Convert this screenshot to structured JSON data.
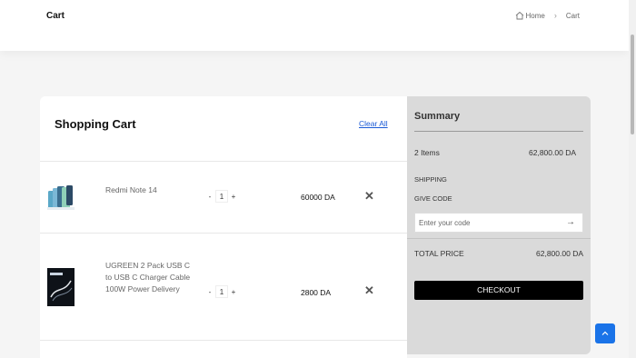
{
  "header": {
    "title": "Cart",
    "breadcrumb": {
      "home_label": "Home",
      "current_label": "Cart"
    }
  },
  "cart": {
    "title": "Shopping Cart",
    "clear_all_label": "Clear All",
    "items": [
      {
        "name": "Redmi Note 14",
        "quantity": "1",
        "price": "60000 DA",
        "minus": "-",
        "plus": "+"
      },
      {
        "name": "UGREEN 2 Pack USB C to USB C Charger Cable 100W Power Delivery",
        "quantity": "1",
        "price": "2800 DA",
        "minus": "-",
        "plus": "+"
      }
    ]
  },
  "summary": {
    "title": "Summary",
    "items_label": "2 Items",
    "items_value": "62,800.00 DA",
    "shipping_label": "SHIPPING",
    "give_code_label": "GIVE CODE",
    "code_placeholder": "Enter your code",
    "total_label": "TOTAL PRICE",
    "total_value": "62,800.00 DA",
    "checkout_label": "CHECKOUT"
  },
  "icons": {
    "home": "home-icon",
    "breadcrumb_separator": "chevron-right-icon",
    "remove": "close-icon",
    "apply_code": "arrow-right-icon",
    "back_to_top": "chevron-up-icon"
  },
  "colors": {
    "accent": "#1a73e8",
    "link": "#1a5ad6",
    "checkout_bg": "#000000",
    "summary_bg": "#dadada"
  }
}
